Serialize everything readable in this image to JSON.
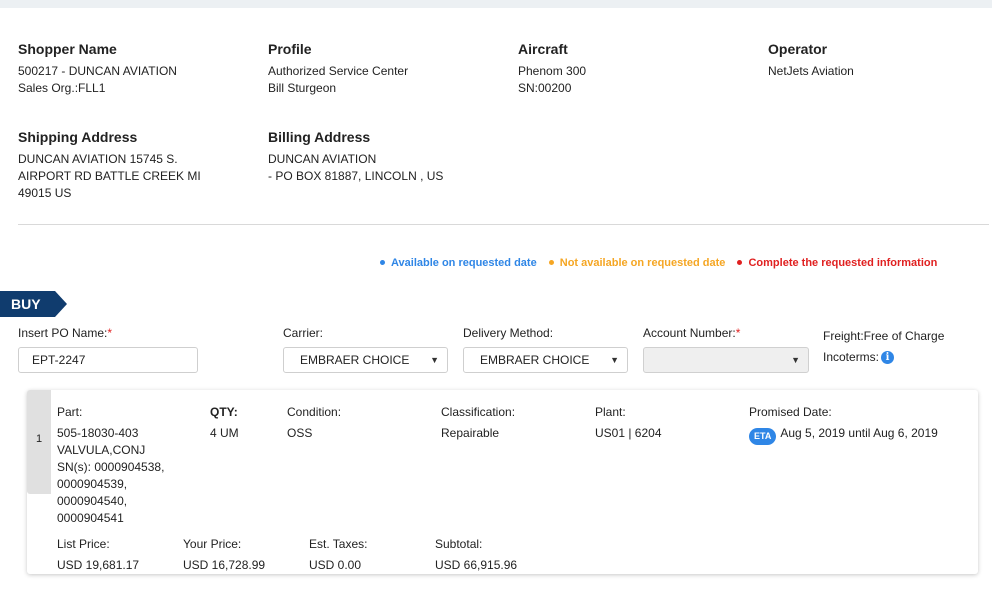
{
  "shopper": {
    "title": "Shopper Name",
    "line1": "500217 - DUNCAN AVIATION",
    "line2": "Sales Org.:FLL1"
  },
  "profile": {
    "title": "Profile",
    "line1": "Authorized Service Center",
    "line2": "Bill Sturgeon"
  },
  "aircraft": {
    "title": "Aircraft",
    "line1": "Phenom 300",
    "line2": "SN:00200"
  },
  "operator": {
    "title": "Operator",
    "line1": "NetJets Aviation"
  },
  "shipping": {
    "title": "Shipping Address",
    "line1": "DUNCAN AVIATION 15745 S.",
    "line2": "AIRPORT RD BATTLE CREEK MI",
    "line3": "49015 US"
  },
  "billing": {
    "title": "Billing Address",
    "line1": "DUNCAN AVIATION",
    "line2": "- PO BOX 81887, LINCOLN , US"
  },
  "legend": {
    "available": {
      "label": "Available on requested date",
      "color": "#2f86e6"
    },
    "not_available": {
      "label": "Not available on requested date",
      "color": "#f5a623"
    },
    "complete": {
      "label": "Complete the requested information",
      "color": "#e02020"
    }
  },
  "section": {
    "buy_label": "BUY"
  },
  "form": {
    "po_label": "Insert PO Name:",
    "po_value": "EPT-2247",
    "carrier_label": "Carrier:",
    "carrier_value": "EMBRAER CHOICE",
    "delivery_label": "Delivery Method:",
    "delivery_value": "EMBRAER CHOICE",
    "account_label": "Account Number:",
    "account_value": "",
    "required_mark": "*",
    "freight": "Freight:Free of Charge",
    "incoterms": "Incoterms:",
    "info_icon": "info-circle-icon"
  },
  "line_item": {
    "index": "1",
    "part_label": "Part:",
    "part_number": "505-18030-403",
    "part_name": "VALVULA,CONJ",
    "serials": [
      "SN(s): 0000904538,",
      "0000904539,",
      "0000904540,",
      "0000904541"
    ],
    "qty_label": "QTY:",
    "qty_value": "4 UM",
    "condition_label": "Condition:",
    "condition_value": "OSS",
    "classification_label": "Classification:",
    "classification_value": "Repairable",
    "plant_label": "Plant:",
    "plant_value": "US01 | 6204",
    "promised_label": "Promised Date:",
    "eta_badge": "ETA",
    "promised_value": "Aug 5, 2019 until Aug 6, 2019",
    "list_price_label": "List Price:",
    "list_price": "USD 19,681.17",
    "your_price_label": "Your Price:",
    "your_price": "USD 16,728.99",
    "taxes_label": "Est. Taxes:",
    "taxes": "USD 0.00",
    "subtotal_label": "Subtotal:",
    "subtotal": "USD 66,915.96"
  }
}
